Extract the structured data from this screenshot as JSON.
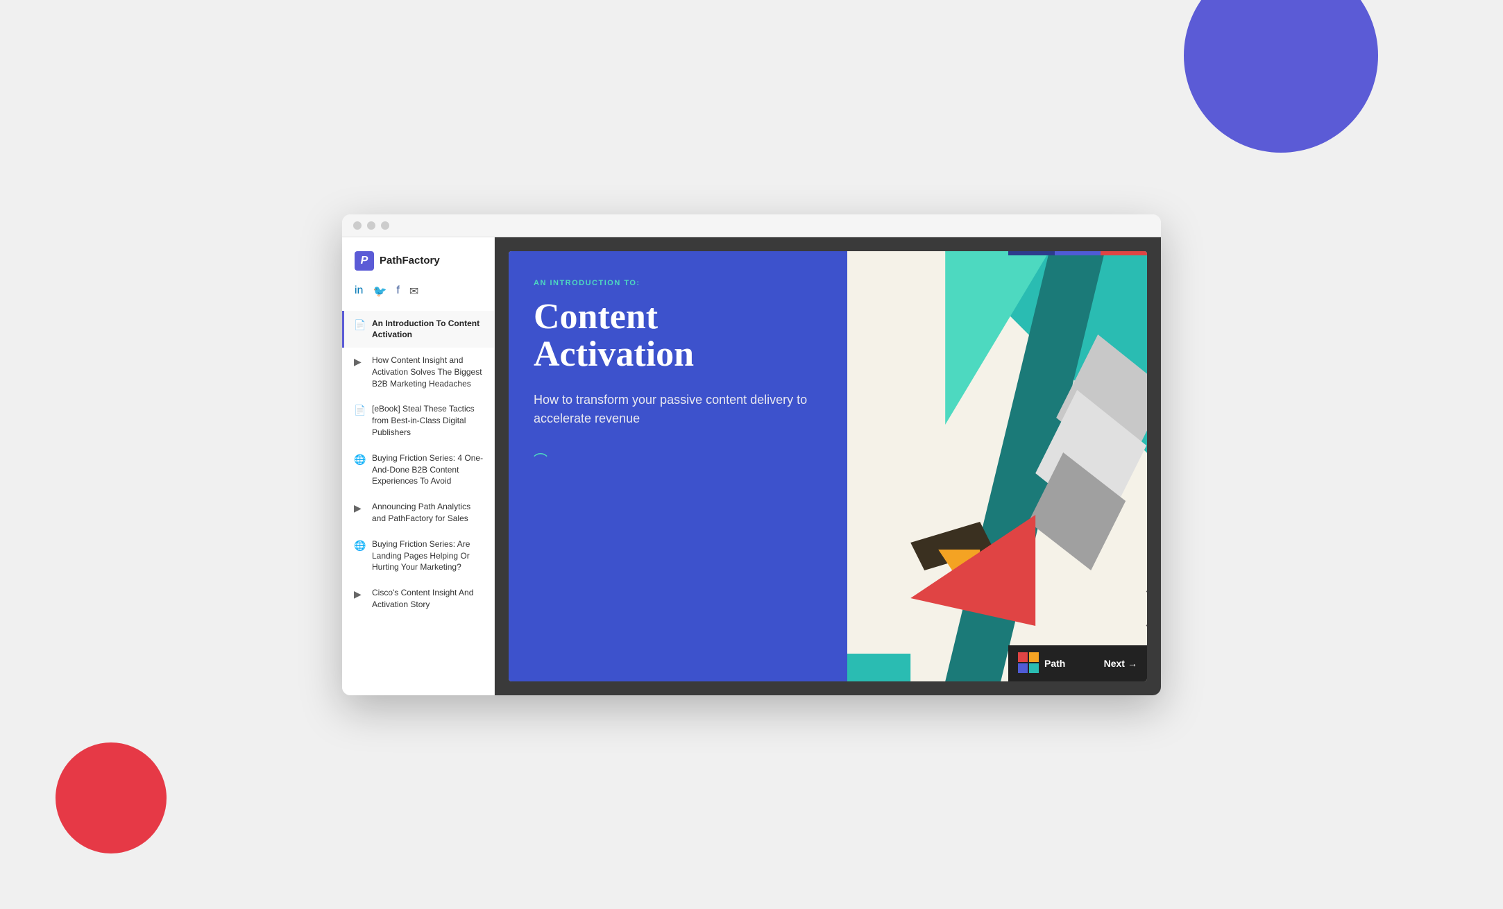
{
  "browser": {
    "dots": [
      "dot1",
      "dot2",
      "dot3"
    ]
  },
  "logo": {
    "letter": "P",
    "name": "PathFactory"
  },
  "social": {
    "linkedin": "in",
    "twitter": "🐦",
    "facebook": "f",
    "email": "✉"
  },
  "sidebar": {
    "items": [
      {
        "id": "item-1",
        "icon": "document",
        "text": "An Introduction To Content Activation",
        "active": true,
        "icon_type": "pdf"
      },
      {
        "id": "item-2",
        "icon": "video",
        "text": "How Content Insight and Activation Solves The Biggest B2B Marketing Headaches",
        "active": false,
        "icon_type": "play"
      },
      {
        "id": "item-3",
        "icon": "document",
        "text": "[eBook] Steal These Tactics from Best-in-Class Digital Publishers",
        "active": false,
        "icon_type": "pdf"
      },
      {
        "id": "item-4",
        "icon": "globe",
        "text": "Buying Friction Series: 4 One-And-Done B2B Content Experiences To Avoid",
        "active": false,
        "icon_type": "globe"
      },
      {
        "id": "item-5",
        "icon": "play",
        "text": "Announcing Path Analytics and PathFactory for Sales",
        "active": false,
        "icon_type": "play"
      },
      {
        "id": "item-6",
        "icon": "globe",
        "text": "Buying Friction Series: Are Landing Pages Helping Or Hurting Your Marketing?",
        "active": false,
        "icon_type": "globe"
      },
      {
        "id": "item-7",
        "icon": "play",
        "text": "Cisco's Content Insight And Activation Story",
        "active": false,
        "icon_type": "play"
      }
    ]
  },
  "slide": {
    "intro_label": "AN INTRODUCTION TO:",
    "title_line1": "Content",
    "title_line2": "Activation",
    "subtitle": "How to transform your passive content delivery to accelerate revenue"
  },
  "bottom_bar": {
    "next_label": "Next",
    "logo_label": "Path"
  },
  "colors": {
    "accent_purple": "#5B5BD6",
    "slide_blue": "#3D52CC",
    "teal": "#2ABCB2",
    "dark_teal": "#1B7A78",
    "orange": "#F4A323",
    "red": "#E04444",
    "bg_slide": "#f5f2e8"
  }
}
